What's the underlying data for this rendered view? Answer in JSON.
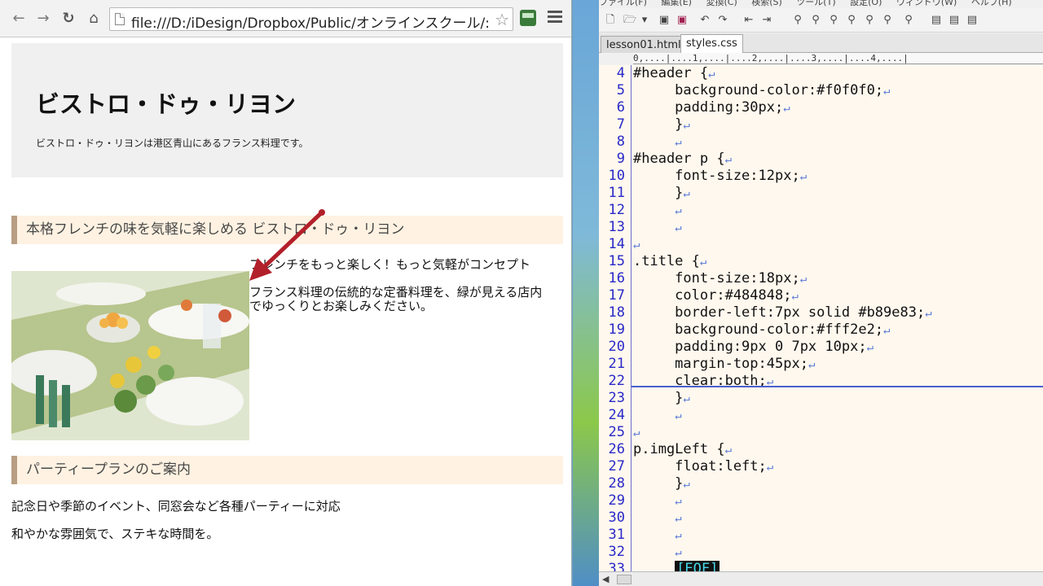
{
  "browser": {
    "url": "file:///D:/iDesign/Dropbox/Public/オンラインスクール/:",
    "nav": {
      "back": "←",
      "forward": "→",
      "reload": "↻",
      "home": "⌂"
    },
    "icons": [
      "page-icon",
      "star-icon",
      "extension-icon",
      "menu-icon"
    ],
    "page": {
      "header_title": "ビストロ・ドゥ・リヨン",
      "header_desc": "ビストロ・ドゥ・リヨンは港区青山にあるフランス料理です。",
      "section1_title": "本格フレンチの味を気軽に楽しめる ビストロ・ドゥ・リヨン",
      "section1_p1": "フレンチをもっと楽しく！もっと気軽がコンセプト",
      "section1_p2_line1": "フランス料理の伝統的な定番料理を、緑が見える店内",
      "section1_p2_line2": "でゆっくりとお楽しみください。",
      "section2_title": "パーティープランのご案内",
      "section2_p1": "記念日や季節のイベント、同窓会など各種パーティーに対応",
      "section2_p2": "和やかな雰囲気で、ステキな時間を。"
    },
    "colors": {
      "header_bg": "#f0f0f0",
      "title_color": "#484848",
      "title_border": "#b89e83",
      "title_bg": "#fff2e2",
      "annotation_arrow": "#b2202a"
    }
  },
  "editor": {
    "menu": [
      "ファイル(F)",
      "編集(E)",
      "変換(C)",
      "検索(S)",
      "ツール(T)",
      "設定(O)",
      "ウィンドウ(W)",
      "ヘルプ(H)"
    ],
    "tabs": [
      "lesson01.html",
      "styles.css"
    ],
    "active_tab": "styles.css",
    "ruler": "0,....|....1,....|....2,....|....3,....|....4,....|",
    "lines": [
      {
        "n": "4",
        "code": "#header {",
        "ret": "↵"
      },
      {
        "n": "5",
        "code": "     background-color:#f0f0f0;",
        "ret": "↵"
      },
      {
        "n": "6",
        "code": "     padding:30px;",
        "ret": "↵"
      },
      {
        "n": "7",
        "code": "     }",
        "ret": "↵"
      },
      {
        "n": "8",
        "code": "     ",
        "ret": "↵"
      },
      {
        "n": "9",
        "code": "#header p {",
        "ret": "↵"
      },
      {
        "n": "10",
        "code": "     font-size:12px;",
        "ret": "↵"
      },
      {
        "n": "11",
        "code": "     }",
        "ret": "↵"
      },
      {
        "n": "12",
        "code": "     ",
        "ret": "↵"
      },
      {
        "n": "13",
        "code": "     ",
        "ret": "↵"
      },
      {
        "n": "14",
        "code": "",
        "ret": "↵"
      },
      {
        "n": "15",
        "code": ".title {",
        "ret": "↵"
      },
      {
        "n": "16",
        "code": "     font-size:18px;",
        "ret": "↵"
      },
      {
        "n": "17",
        "code": "     color:#484848;",
        "ret": "↵"
      },
      {
        "n": "18",
        "code": "     border-left:7px solid #b89e83;",
        "ret": "↵"
      },
      {
        "n": "19",
        "code": "     background-color:#fff2e2;",
        "ret": "↵"
      },
      {
        "n": "20",
        "code": "     padding:9px 0 7px 10px;",
        "ret": "↵"
      },
      {
        "n": "21",
        "code": "     margin-top:45px;",
        "ret": "↵"
      },
      {
        "n": "22",
        "code": "     clear:both;",
        "ret": "↵"
      },
      {
        "n": "23",
        "code": "     }",
        "ret": "↵"
      },
      {
        "n": "24",
        "code": "     ",
        "ret": "↵"
      },
      {
        "n": "25",
        "code": "",
        "ret": "↵"
      },
      {
        "n": "26",
        "code": "p.imgLeft {",
        "ret": "↵"
      },
      {
        "n": "27",
        "code": "     float:left;",
        "ret": "↵"
      },
      {
        "n": "28",
        "code": "     }",
        "ret": "↵"
      },
      {
        "n": "29",
        "code": "     ",
        "ret": "↵"
      },
      {
        "n": "30",
        "code": "     ",
        "ret": "↵"
      },
      {
        "n": "31",
        "code": "     ",
        "ret": "↵"
      },
      {
        "n": "32",
        "code": "     ",
        "ret": "↵"
      },
      {
        "n": "33",
        "code": "     ",
        "ret": ""
      }
    ],
    "eof_marker": "[EOF]"
  }
}
